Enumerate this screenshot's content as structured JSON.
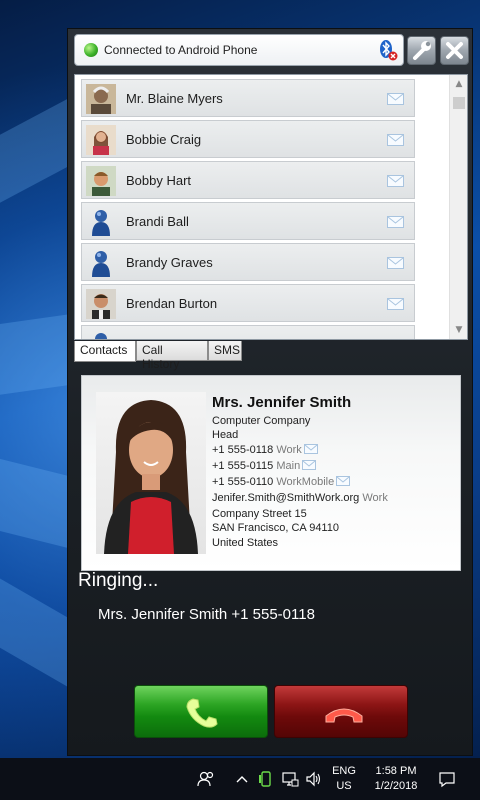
{
  "window": {
    "status_text": "Connected to Android Phone",
    "status_color": "#3db22a",
    "icons": {
      "bluetooth": "bluetooth-icon",
      "settings": "wrench-icon",
      "close": "close-icon"
    }
  },
  "contacts": [
    {
      "name": "Mr. Blaine Myers",
      "avatar": "photo"
    },
    {
      "name": "Bobbie Craig",
      "avatar": "photo"
    },
    {
      "name": "Bobby Hart",
      "avatar": "photo"
    },
    {
      "name": "Brandi Ball",
      "avatar": "generic-person"
    },
    {
      "name": "Brandy Graves",
      "avatar": "generic-person"
    },
    {
      "name": "Brendan Burton",
      "avatar": "photo"
    }
  ],
  "tabs": [
    "Contacts",
    "Call History",
    "SMS"
  ],
  "card": {
    "name": "Mrs. Jennifer Smith",
    "company": "Computer Company",
    "title": "Head",
    "phones": [
      {
        "number": "+1 555-0118",
        "type": "Work"
      },
      {
        "number": "+1 555-0115",
        "type": "Main"
      },
      {
        "number": "+1 555-0110",
        "type": "WorkMobile"
      }
    ],
    "email": {
      "address": "Jenifer.Smith@SmithWork.org",
      "type": "Work"
    },
    "address_street": "Company Street 15",
    "address_city": "SAN Francisco, CA 94110",
    "address_country": "United States"
  },
  "call": {
    "status": "Ringing...",
    "caller_name": "Mrs. Jennifer Smith",
    "caller_number": "+1 555-0118",
    "answer_color": "#138a10",
    "hangup_color": "#8e1616"
  },
  "taskbar": {
    "lang_line1": "ENG",
    "lang_line2": "US",
    "time": "1:58 PM",
    "date": "1/2/2018"
  }
}
